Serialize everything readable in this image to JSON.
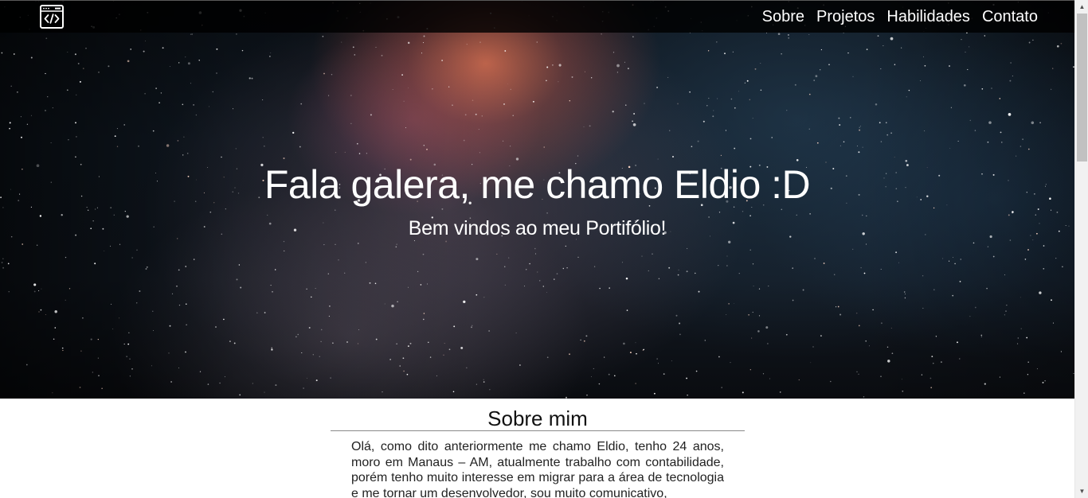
{
  "navbar": {
    "logo_icon": "code-window-icon",
    "links": [
      {
        "label": "Sobre"
      },
      {
        "label": "Projetos"
      },
      {
        "label": "Habilidades"
      },
      {
        "label": "Contato"
      }
    ]
  },
  "hero": {
    "title": "Fala galera, me chamo Eldio :D",
    "subtitle": "Bem vindos ao meu Portifólio!"
  },
  "about": {
    "title": "Sobre mim",
    "text": "Olá, como dito anteriormente me chamo Eldio, tenho 24 anos, moro em Manaus – AM, atualmente trabalho com contabilidade, porém tenho muito interesse em migrar para a área de tecnologia e me tornar um desenvolvedor, sou muito comunicativo,"
  },
  "scrollbar": {
    "up_icon": "chevron-up-icon",
    "down_icon": "chevron-down-icon"
  },
  "colors": {
    "navbar_bg": "#000000",
    "text_light": "#ffffff",
    "text_dark": "#111111"
  }
}
